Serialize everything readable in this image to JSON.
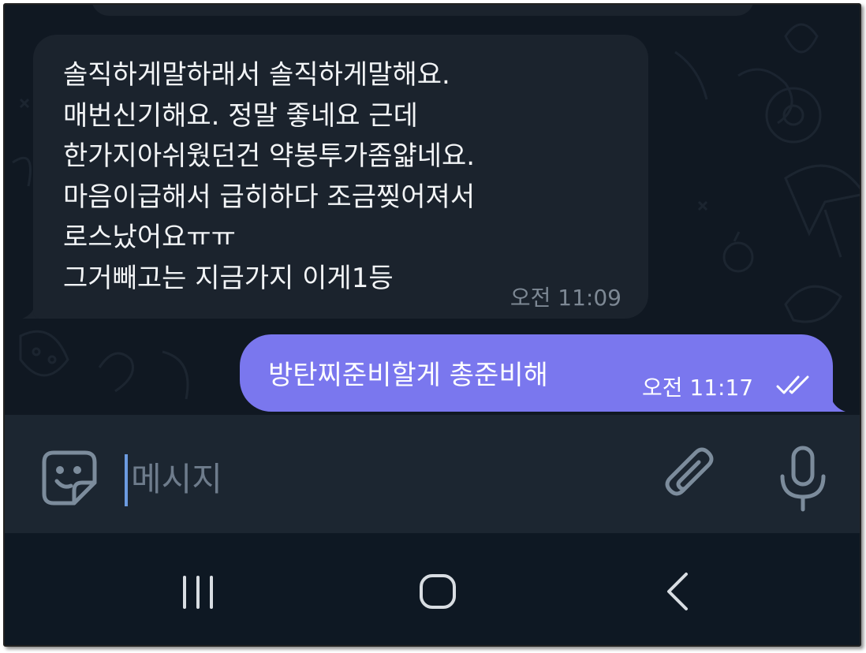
{
  "messages": {
    "incoming": {
      "text": "솔직하게말하래서 솔직하게말해요.\n매번신기해요. 정말 좋네요 근데\n한가지아쉬웠던건 약봉투가좀얇네요.\n마음이급해서 급히하다 조금찢어져서\n로스났어요ㅠㅠ\n그거빼고는 지금가지 이게1등",
      "time": "오전 11:09"
    },
    "outgoing": {
      "text": "방탄찌준비할게 총준비해",
      "time": "오전 11:17",
      "status_icon": "double-check-icon"
    }
  },
  "input_bar": {
    "placeholder": "메시지",
    "icons": [
      "sticker-icon",
      "paperclip-icon",
      "microphone-icon"
    ]
  },
  "nav_bar": {
    "icons": [
      "recent-apps-icon",
      "home-icon",
      "back-icon"
    ]
  },
  "colors": {
    "chat_background": "#101822",
    "incoming_bubble": "#1b232d",
    "outgoing_bubble": "#7a77ee",
    "input_bar": "#1c2631",
    "nav_bar": "#0e1823",
    "cursor": "#6c9be0"
  }
}
